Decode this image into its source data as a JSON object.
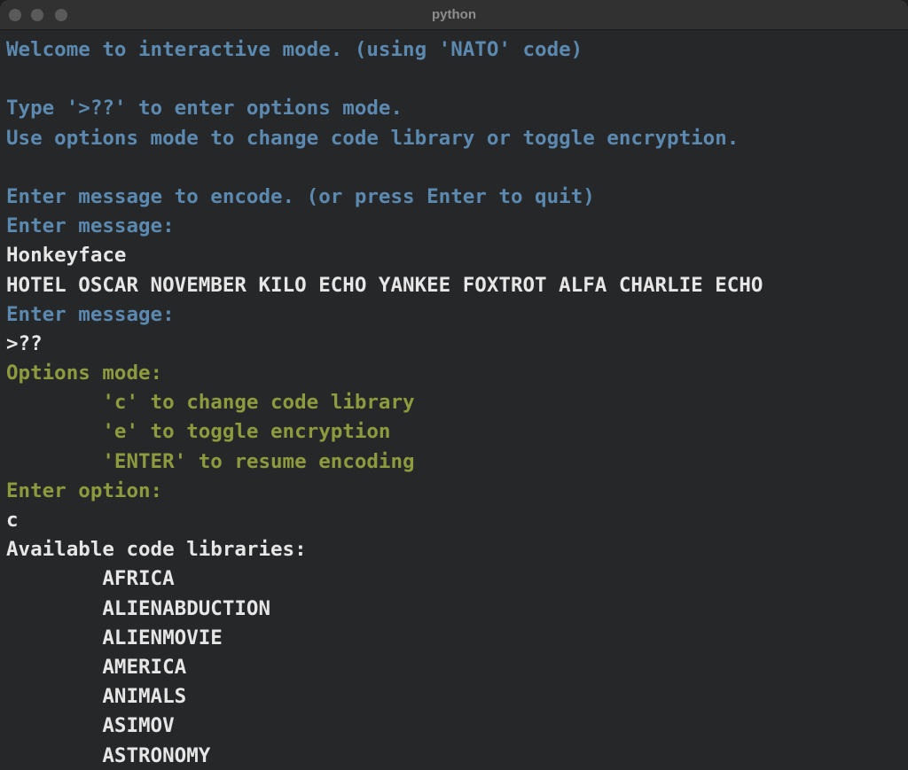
{
  "window": {
    "title": "python"
  },
  "terminal": {
    "lines": [
      {
        "text": "Welcome to interactive mode. (using 'NATO' code)",
        "style": "blue"
      },
      {
        "text": "",
        "style": "blue"
      },
      {
        "text": "Type '>??' to enter options mode.",
        "style": "blue"
      },
      {
        "text": "Use options mode to change code library or toggle encryption.",
        "style": "blue"
      },
      {
        "text": "",
        "style": "blue"
      },
      {
        "text": "Enter message to encode. (or press Enter to quit)",
        "style": "blue"
      },
      {
        "text": "Enter message:",
        "style": "blue"
      },
      {
        "text": "Honkeyface",
        "style": "white"
      },
      {
        "text": "HOTEL OSCAR NOVEMBER KILO ECHO YANKEE FOXTROT ALFA CHARLIE ECHO",
        "style": "white"
      },
      {
        "text": "Enter message:",
        "style": "blue"
      },
      {
        "text": ">??",
        "style": "white"
      },
      {
        "text": "Options mode:",
        "style": "olive"
      },
      {
        "text": "        'c' to change code library",
        "style": "olive"
      },
      {
        "text": "        'e' to toggle encryption",
        "style": "olive"
      },
      {
        "text": "        'ENTER' to resume encoding",
        "style": "olive"
      },
      {
        "text": "Enter option:",
        "style": "olive"
      },
      {
        "text": "c",
        "style": "white"
      },
      {
        "text": "Available code libraries:",
        "style": "white"
      },
      {
        "text": "        AFRICA",
        "style": "white"
      },
      {
        "text": "        ALIENABDUCTION",
        "style": "white"
      },
      {
        "text": "        ALIENMOVIE",
        "style": "white"
      },
      {
        "text": "        AMERICA",
        "style": "white"
      },
      {
        "text": "        ANIMALS",
        "style": "white"
      },
      {
        "text": "        ASIMOV",
        "style": "white"
      },
      {
        "text": "        ASTRONOMY",
        "style": "white"
      }
    ]
  }
}
